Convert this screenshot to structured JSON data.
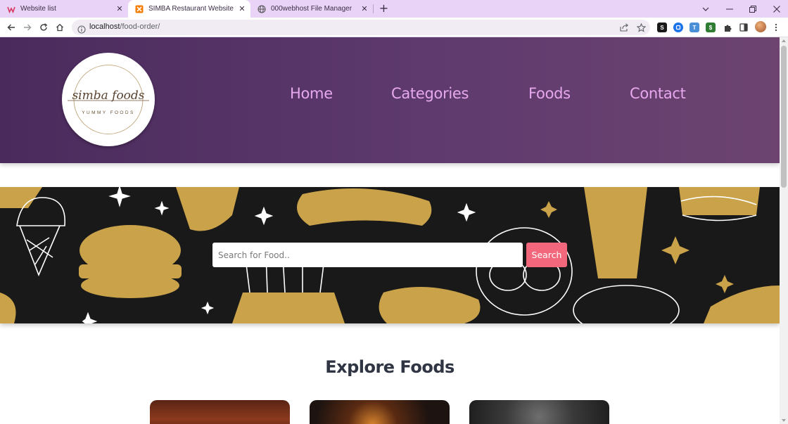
{
  "browser": {
    "tabs": [
      {
        "title": "Website list",
        "icon": "wix-icon",
        "active": false
      },
      {
        "title": "SIMBA Restaurant Website",
        "icon": "xampp-icon",
        "active": true
      },
      {
        "title": "000webhost File Manager",
        "icon": "globe-icon",
        "active": false
      }
    ],
    "url_host": "localhost",
    "url_path": "/food-order/",
    "extensions": [
      "s-extension",
      "shield-extension",
      "translate-extension",
      "dollar-extension",
      "puzzle-icon"
    ]
  },
  "site": {
    "logo": {
      "line1": "simba foods",
      "line2": "YUMMY FOODS"
    },
    "nav": [
      "Home",
      "Categories",
      "Foods",
      "Contact"
    ],
    "search": {
      "placeholder": "Search for Food..",
      "button_label": "Search"
    },
    "explore_title": "Explore Foods",
    "colors": {
      "header_start": "#4a2a5c",
      "header_end": "#6d4470",
      "nav_text": "#e7a8ee",
      "search_button": "#f2677c",
      "hero_background": "#191919",
      "hero_illustration": "#c9a24a",
      "title_text": "#2f3542"
    }
  }
}
